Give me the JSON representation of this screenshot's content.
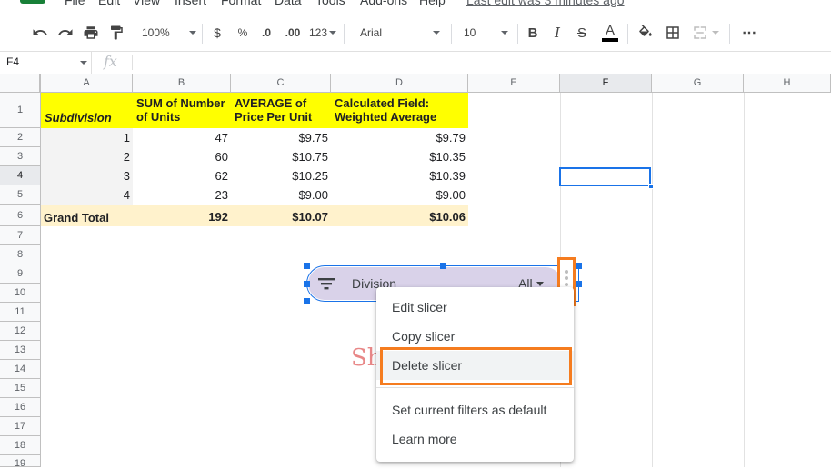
{
  "menu": {
    "items": [
      "File",
      "Edit",
      "View",
      "Insert",
      "Format",
      "Data",
      "Tools",
      "Add-ons",
      "Help"
    ],
    "last_edit": "Last edit was 3 minutes ago"
  },
  "toolbar": {
    "zoom": "100%",
    "currency": "$",
    "percent": "%",
    "decrease_decimals": ".0",
    "increase_decimals": ".00",
    "more_formats": "123",
    "font": "Arial",
    "font_size": "10",
    "bold": "B",
    "italic": "I",
    "strikethrough": "S",
    "text_color_letter": "A",
    "more": "⋯",
    "text_color_bar": "#000000"
  },
  "formula_bar": {
    "name_box": "F4",
    "fx": "fx",
    "value": ""
  },
  "columns": [
    "A",
    "B",
    "C",
    "D",
    "E",
    "F",
    "G",
    "H"
  ],
  "rows": [
    "1",
    "2",
    "3",
    "4",
    "5",
    "6",
    "7",
    "8",
    "9",
    "10",
    "11",
    "12",
    "13",
    "14",
    "15",
    "16",
    "17",
    "18",
    "19"
  ],
  "pivot": {
    "header": {
      "a": "Subdivision",
      "b": "SUM of Number of Units",
      "c": "AVERAGE of Price Per Unit",
      "d": "Calculated Field: Weighted Average"
    },
    "rows": [
      [
        "1",
        "47",
        "$9.75",
        "$9.79"
      ],
      [
        "2",
        "60",
        "$10.75",
        "$10.35"
      ],
      [
        "3",
        "62",
        "$10.25",
        "$10.39"
      ],
      [
        "4",
        "23",
        "$9.00",
        "$9.00"
      ]
    ],
    "total": [
      "Grand Total",
      "192",
      "$10.07",
      "$10.06"
    ]
  },
  "slicer": {
    "label": "Division",
    "value": "All"
  },
  "context_menu": {
    "items": [
      "Edit slicer",
      "Copy slicer",
      "Delete slicer",
      "Set current filters as default",
      "Learn more"
    ]
  },
  "watermark": "Sh",
  "colors": {
    "header_fill": "#ffff00",
    "total_fill": "#fff2cc",
    "slicer_fill": "#d9d2e9",
    "selection": "#1a73e8",
    "annotation": "#f57c1f"
  }
}
